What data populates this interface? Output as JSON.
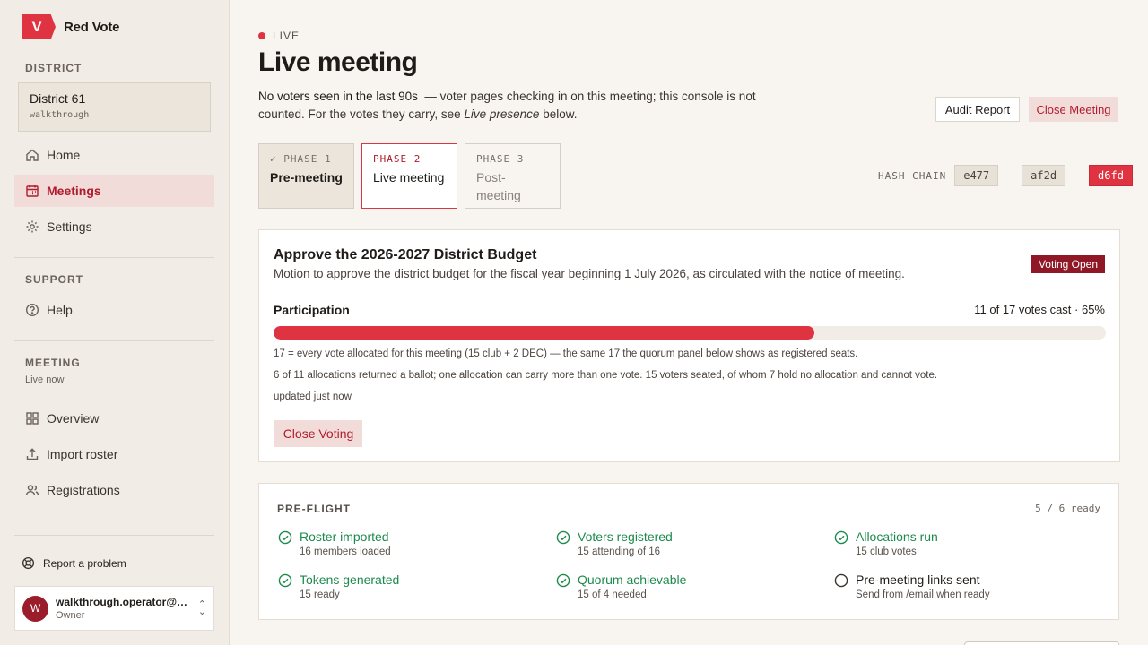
{
  "brand": {
    "logo_letter": "V",
    "name": "Red Vote",
    "accent": "#e03342"
  },
  "sidebar": {
    "district_label": "DISTRICT",
    "district_name": "District 61",
    "district_sub": "walkthrough",
    "nav": [
      {
        "label": "Home",
        "icon": "home-icon"
      },
      {
        "label": "Meetings",
        "icon": "calendar-icon",
        "active": true
      },
      {
        "label": "Settings",
        "icon": "gear-icon"
      }
    ],
    "support_label": "SUPPORT",
    "support": [
      {
        "label": "Help",
        "icon": "help-icon"
      }
    ],
    "meeting_label": "MEETING",
    "meeting_status": "Live now",
    "meeting_nav": [
      {
        "label": "Overview",
        "icon": "grid-icon"
      },
      {
        "label": "Import roster",
        "icon": "upload-icon"
      },
      {
        "label": "Registrations",
        "icon": "users-icon"
      }
    ],
    "report_label": "Report a problem",
    "user": {
      "initial": "W",
      "email": "walkthrough.operator@ta...",
      "role": "Owner"
    }
  },
  "header": {
    "live_label": "LIVE",
    "title": "Live meeting",
    "desc_strong": "No voters seen in the last 90s",
    "desc_rest": "— voter pages checking in on this meeting; this console is not counted. For the votes they carry, see",
    "desc_em": "Live presence",
    "desc_end": "below.",
    "audit_label": "Audit Report",
    "close_label": "Close Meeting"
  },
  "phases": [
    {
      "label": "✓ PHASE 1",
      "name": "Pre-meeting"
    },
    {
      "label": "PHASE 2",
      "name": "Live meeting"
    },
    {
      "label": "PHASE 3",
      "name": "Post-meeting"
    }
  ],
  "hash_chain": {
    "label": "HASH CHAIN",
    "items": [
      "e477",
      "af2d",
      "d6fd"
    ]
  },
  "motion": {
    "title": "Approve the 2026-2027 District Budget",
    "description": "Motion to approve the district budget for the fiscal year beginning 1 July 2026, as circulated with the notice of meeting.",
    "status_badge": "Voting Open",
    "participation_label": "Participation",
    "participation_count": "11 of 17 votes cast · 65%",
    "participation_fraction": 0.65,
    "note1": "17 = every vote allocated for this meeting (15 club + 2 DEC) — the same 17 the quorum panel below shows as registered seats.",
    "note2": "6 of 11 allocations returned a ballot; one allocation can carry more than one vote. 15 voters seated, of whom 7 hold no allocation and cannot vote.",
    "updated": "updated just now",
    "close_voting_label": "Close Voting"
  },
  "preflight": {
    "title": "PRE-FLIGHT",
    "count": "5 / 6 ready",
    "items": [
      {
        "name": "Roster imported",
        "sub": "16 members loaded",
        "done": true
      },
      {
        "name": "Voters registered",
        "sub": "15 attending of 16",
        "done": true
      },
      {
        "name": "Allocations run",
        "sub": "15 club votes",
        "done": true
      },
      {
        "name": "Tokens generated",
        "sub": "15 ready",
        "done": true
      },
      {
        "name": "Quorum achievable",
        "sub": "15 of 4 needed",
        "done": true
      },
      {
        "name": "Pre-meeting links sent",
        "sub": "Send from /email when ready",
        "done": false
      }
    ]
  }
}
